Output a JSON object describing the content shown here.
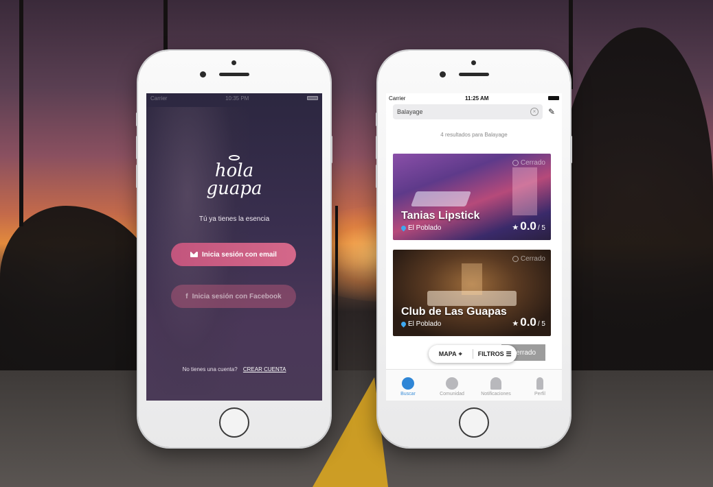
{
  "login": {
    "status": {
      "carrier": "Carrier",
      "time": "10:35 PM"
    },
    "logo": {
      "line1": "hola",
      "line2": "guapa"
    },
    "tagline": "Tú ya tienes la esencia",
    "email_button": "Inicia sesión con email",
    "facebook_button": "Inicia sesión con Facebook",
    "no_account_text": "No tienes una cuenta?",
    "create_account_link": "CREAR CUENTA"
  },
  "results": {
    "status": {
      "carrier": "Carrier",
      "time": "11:25 AM"
    },
    "search": {
      "value": "Balayage"
    },
    "result_count": "4 resultados para Balayage",
    "cards": [
      {
        "name": "Tanias Lipstick",
        "location": "El Poblado",
        "status": "Cerrado",
        "score": "0.0",
        "out_of": "/ 5"
      },
      {
        "name": "Club de Las Guapas",
        "location": "El Poblado",
        "status": "Cerrado",
        "score": "0.0",
        "out_of": "/ 5"
      }
    ],
    "peek_status": "Cerrado",
    "toggle": {
      "map": "MAPA",
      "filters": "FILTROS"
    },
    "tabs": [
      {
        "label": "Buscar",
        "icon": "search-icon",
        "active": true
      },
      {
        "label": "Comunidad",
        "icon": "chat-icon",
        "active": false
      },
      {
        "label": "Notificaciones",
        "icon": "bell-icon",
        "active": false
      },
      {
        "label": "Perfil",
        "icon": "person-icon",
        "active": false
      }
    ]
  },
  "colors": {
    "accent_pink": "#c2557d",
    "active_blue": "#2f86d6",
    "pin_blue": "#3ea8f0"
  }
}
